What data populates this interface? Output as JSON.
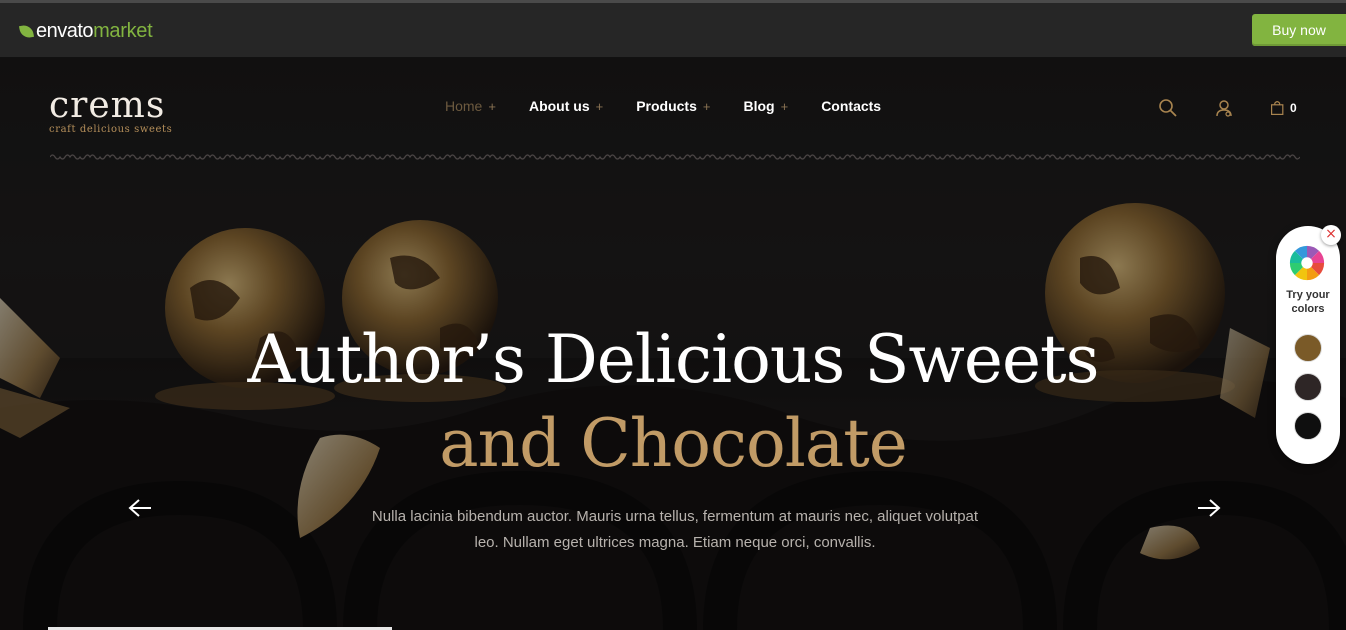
{
  "envato": {
    "brand_main": "envato",
    "brand_sub": "market",
    "buy_label": "Buy now",
    "accent": "#82b440"
  },
  "site": {
    "logo": "crems",
    "tagline": "craft delicious sweets"
  },
  "nav": {
    "items": [
      {
        "label": "Home",
        "active": true,
        "has_sub": true
      },
      {
        "label": "About us",
        "active": false,
        "has_sub": true
      },
      {
        "label": "Products",
        "active": false,
        "has_sub": true
      },
      {
        "label": "Blog",
        "active": false,
        "has_sub": true
      },
      {
        "label": "Contacts",
        "active": false,
        "has_sub": false
      }
    ],
    "sub_marker": "+",
    "cart_count": "0",
    "icons": [
      "search-icon",
      "user-icon",
      "shopping-bag-icon"
    ]
  },
  "hero": {
    "headline_line1": "Author’s Delicious Sweets",
    "headline_line2": "and Chocolate",
    "description": "Nulla lacinia bibendum auctor. Mauris urna tellus, fermentum at mauris nec, aliquet volutpat leo. Nullam eget ultrices magna. Etiam neque orci, convallis.",
    "accent_color": "#c19b66",
    "arrows": [
      "arrow-left-icon",
      "arrow-right-icon"
    ]
  },
  "color_widget": {
    "label": "Try your colors",
    "close": "×",
    "swatches": [
      "#7a5a28",
      "#2e2626",
      "#0f0f0f"
    ]
  }
}
